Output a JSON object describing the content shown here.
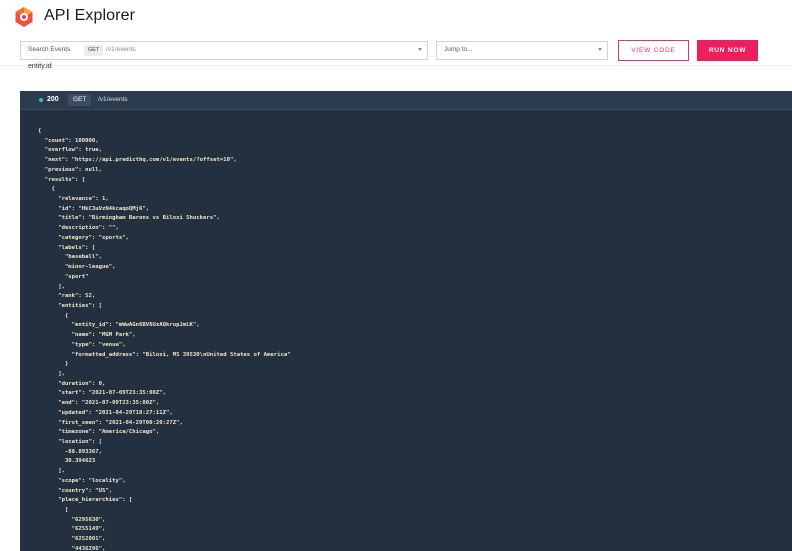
{
  "header": {
    "title": "API Explorer",
    "logo_icon": "predicthq-logo-icon"
  },
  "toolbar": {
    "search_label": "Search Events",
    "method": "GET",
    "path": "/v1/events",
    "jump_placeholder": "Jump to...",
    "view_code_label": "VIEW CODE",
    "run_now_label": "RUN NOW"
  },
  "param_label": "entity.id",
  "response": {
    "status_code": "200",
    "method": "GET",
    "path": "/v1/events",
    "status_color": "#36c9a4"
  },
  "colors": {
    "accent": "#ec1f5f",
    "code_bg": "#233040",
    "code_text": "#f3e6c5"
  },
  "code_lines": [
    "{",
    "  \"count\": 100000,",
    "  \"overflow\": true,",
    "  \"next\": \"https://api.predicthq.com/v1/events/?offset=10\",",
    "  \"previous\": null,",
    "  \"results\": [",
    "    {",
    "      \"relevance\": 1,",
    "      \"id\": \"HkC3uVzN4kcaqoQMj6\",",
    "      \"title\": \"Birmingham Barons vs Biloxi Shuckers\",",
    "      \"description\": \"\",",
    "      \"category\": \"sports\",",
    "      \"labels\": [",
    "        \"baseball\",",
    "        \"minor-league\",",
    "        \"sport\"",
    "      ],",
    "      \"rank\": 52,",
    "      \"entities\": [",
    "        {",
    "          \"entity_id\": \"mWwAGn6BV6UzAQkrupJmLK\",",
    "          \"name\": \"MGM Park\",",
    "          \"type\": \"venue\",",
    "          \"formatted_address\": \"Biloxi, MS 39530\\nUnited States of America\"",
    "        }",
    "      ],",
    "      \"duration\": 0,",
    "      \"start\": \"2021-07-09T23:35:00Z\",",
    "      \"end\": \"2021-07-09T23:35:00Z\",",
    "      \"updated\": \"2021-04-29T18:27:11Z\",",
    "      \"first_seen\": \"2021-04-29T00:20:27Z\",",
    "      \"timezone\": \"America/Chicago\",",
    "      \"location\": [",
    "        -88.893367,",
    "        30.394623",
    "      ],",
    "      \"scope\": \"locality\",",
    "      \"country\": \"US\",",
    "      \"place_hierarchies\": [",
    "        [",
    "          \"6295630\",",
    "          \"6255149\",",
    "          \"6252001\",",
    "          \"4436296\","
  ]
}
